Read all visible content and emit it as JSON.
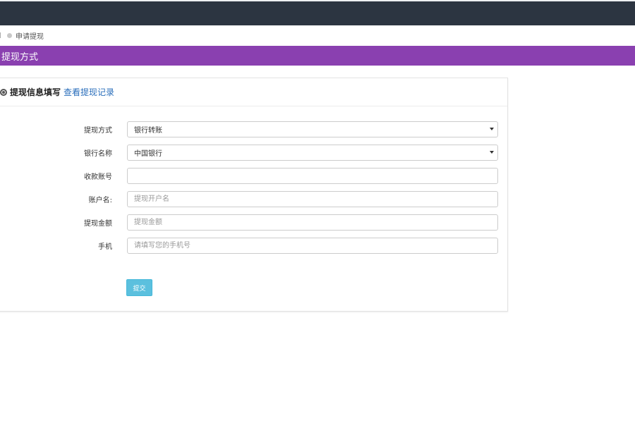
{
  "breadcrumb": {
    "current": "申请提现"
  },
  "section": {
    "title": "提现方式"
  },
  "panel": {
    "title": "提现信息填写",
    "link": "查看提现记录"
  },
  "form": {
    "method": {
      "label": "提现方式",
      "value": "银行转账"
    },
    "bank": {
      "label": "银行名称",
      "value": "中国银行"
    },
    "account": {
      "label": "收款账号",
      "placeholder": ""
    },
    "holder": {
      "label": "账户名:",
      "placeholder": "提现开户名"
    },
    "amount": {
      "label": "提现金额",
      "placeholder": "提现金额"
    },
    "phone": {
      "label": "手机",
      "placeholder": "请填写您的手机号"
    },
    "submit": "提交"
  },
  "colors": {
    "topbar": "#2c3541",
    "section_bar": "#8a40b0",
    "link": "#2a6ebb",
    "submit": "#5bc0de"
  }
}
